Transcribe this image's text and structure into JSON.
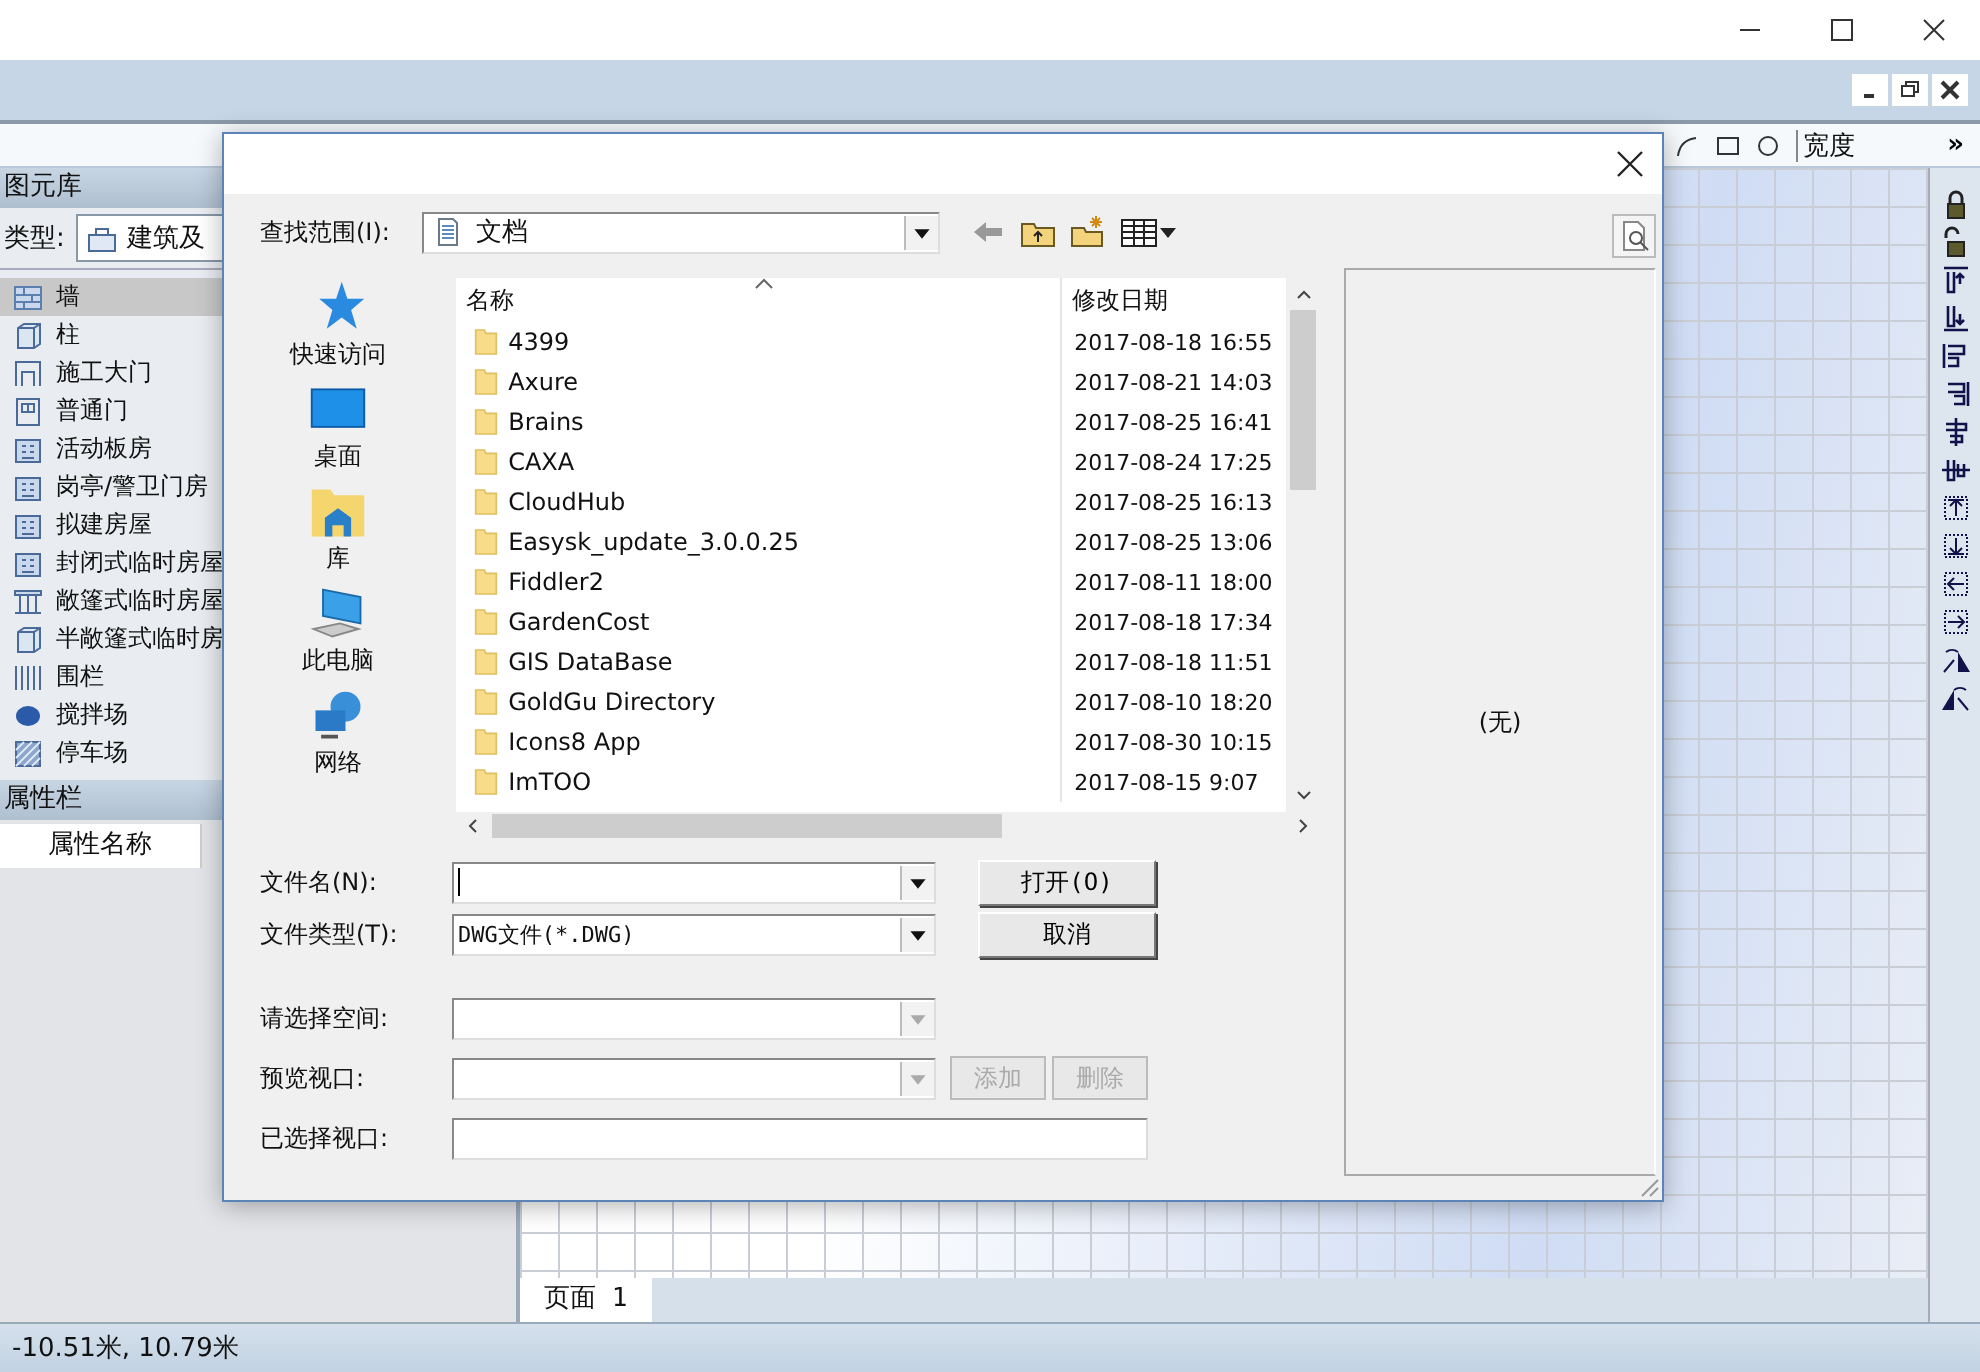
{
  "toolbar": {
    "width_label": "宽度",
    "overflow": "»"
  },
  "library": {
    "title": "图元库",
    "type_label": "类型:",
    "type_value": "建筑及",
    "items": [
      {
        "label": "墙",
        "kind": "brick",
        "selected": true
      },
      {
        "label": "柱",
        "kind": "cube",
        "selected": false
      },
      {
        "label": "施工大门",
        "kind": "gate",
        "selected": false
      },
      {
        "label": "普通门",
        "kind": "door",
        "selected": false
      },
      {
        "label": "活动板房",
        "kind": "building",
        "selected": false
      },
      {
        "label": "岗亭/警卫门房",
        "kind": "building",
        "selected": false
      },
      {
        "label": "拟建房屋",
        "kind": "building",
        "selected": false
      },
      {
        "label": "封闭式临时房屋",
        "kind": "building",
        "selected": false
      },
      {
        "label": "敞篷式临时房屋",
        "kind": "pillars",
        "selected": false
      },
      {
        "label": "半敞篷式临时房",
        "kind": "cube",
        "selected": false
      },
      {
        "label": "围栏",
        "kind": "fence",
        "selected": false
      },
      {
        "label": "搅拌场",
        "kind": "disc",
        "selected": false
      },
      {
        "label": "停车场",
        "kind": "hatch",
        "selected": false
      }
    ]
  },
  "properties": {
    "title": "属性栏",
    "column_1": "属性名称"
  },
  "page_tabs": [
    {
      "label": "页面 1",
      "selected": true
    }
  ],
  "status_bar": {
    "coordinates": "-10.51米, 10.79米"
  },
  "dialog": {
    "look_in_label": "查找范围(I):",
    "look_in_value": "文档",
    "places": [
      {
        "label": "快速访问",
        "kind": "star"
      },
      {
        "label": "桌面",
        "kind": "desktop"
      },
      {
        "label": "库",
        "kind": "library"
      },
      {
        "label": "此电脑",
        "kind": "computer"
      },
      {
        "label": "网络",
        "kind": "network"
      }
    ],
    "columns": [
      "名称",
      "修改日期"
    ],
    "files": [
      {
        "name": "4399",
        "modified": "2017-08-18 16:55"
      },
      {
        "name": "Axure",
        "modified": "2017-08-21 14:03"
      },
      {
        "name": "Brains",
        "modified": "2017-08-25 16:41"
      },
      {
        "name": "CAXA",
        "modified": "2017-08-24 17:25"
      },
      {
        "name": "CloudHub",
        "modified": "2017-08-25 16:13"
      },
      {
        "name": "Easysk_update_3.0.0.25",
        "modified": "2017-08-25 13:06"
      },
      {
        "name": "Fiddler2",
        "modified": "2017-08-11 18:00"
      },
      {
        "name": "GardenCost",
        "modified": "2017-08-18 17:34"
      },
      {
        "name": "GIS DataBase",
        "modified": "2017-08-18 11:51"
      },
      {
        "name": "GoldGu Directory",
        "modified": "2017-08-10 18:20"
      },
      {
        "name": "Icons8 App",
        "modified": "2017-08-30 10:15"
      },
      {
        "name": "ImTOO",
        "modified": "2017-08-15 9:07"
      }
    ],
    "file_name_label": "文件名(N):",
    "file_type_label": "文件类型(T):",
    "file_type_value": "DWG文件(*.DWG)",
    "space_label": "请选择空间:",
    "viewport_label": "预览视口:",
    "chosen_label": "已选择视口:",
    "buttons": [
      {
        "label": "打开(O)",
        "disabled": false
      },
      {
        "label": "取消",
        "disabled": false
      }
    ],
    "viewport_buttons": [
      {
        "label": "添加",
        "disabled": true
      },
      {
        "label": "删除",
        "disabled": true
      }
    ],
    "preview_text": "(无)"
  }
}
